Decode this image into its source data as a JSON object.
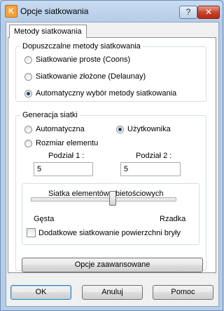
{
  "window": {
    "title": "Opcje siatkowania",
    "help_label": "?",
    "close_label": "✕"
  },
  "tab": {
    "label": "Metody siatkowania"
  },
  "methods_group": {
    "title": "Dopuszczalne metody siatkowania",
    "options": [
      {
        "label": "Siatkowanie proste (Coons)",
        "selected": false
      },
      {
        "label": "Siatkowanie złożone (Delaunay)",
        "selected": false
      },
      {
        "label": "Automatyczny wybór metody siatkowania",
        "selected": true
      }
    ]
  },
  "generation_group": {
    "title": "Generacja siatki",
    "auto_label": "Automatyczna",
    "user_label": "Użytkownika",
    "element_size_label": "Rozmiar elementu",
    "division1_label": "Podział 1 :",
    "division1_value": "5",
    "division2_label": "Podział 2 :",
    "division2_value": "5",
    "selected": "user"
  },
  "volume_group": {
    "title": "Siatka elementów obietościowych",
    "left_label": "Gęsta",
    "right_label": "Rzadka",
    "slider_value": 0.57,
    "surface_checkbox_label": "Dodatkowe siatkowanie powierzchni bryły",
    "surface_checked": false
  },
  "advanced_button": "Opcje zaawansowane",
  "buttons": {
    "ok": "OK",
    "cancel": "Anuluj",
    "help": "Pomoc"
  }
}
